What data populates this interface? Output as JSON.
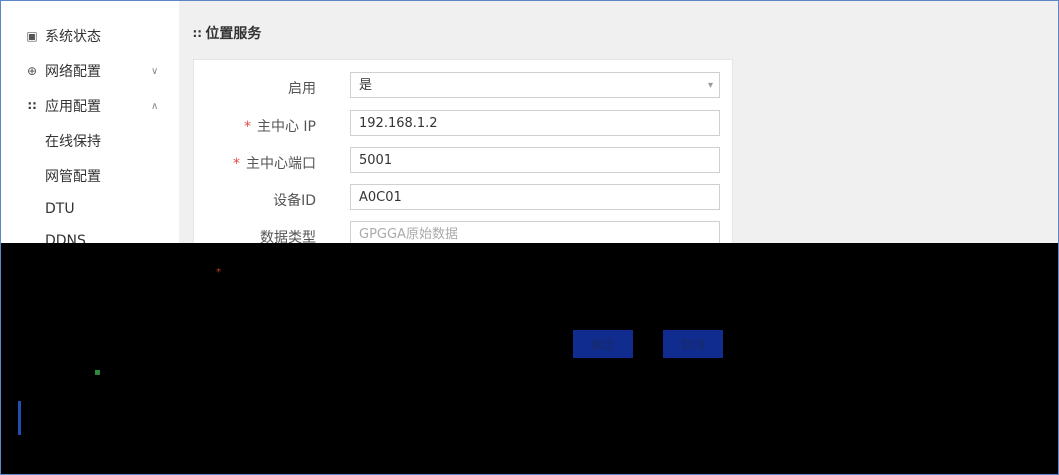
{
  "sidebar": {
    "items": [
      {
        "label": "系统状态",
        "icon": "monitor-icon"
      },
      {
        "label": "网络配置",
        "icon": "globe-icon",
        "caret": "∨"
      },
      {
        "label": "应用配置",
        "icon": "grid-icon",
        "caret": "∧"
      }
    ],
    "subitems": [
      "在线保持",
      "网管配置",
      "DTU",
      "DDNS"
    ]
  },
  "main": {
    "title": "位置服务",
    "form": {
      "enable": {
        "label": "启用",
        "value": "是",
        "options": [
          "是"
        ]
      },
      "center_ip": {
        "label": "主中心 IP",
        "value": "192.168.1.2",
        "required": true
      },
      "center_port": {
        "label": "主中心端口",
        "value": "5001",
        "required": true
      },
      "device_id": {
        "label": "设备ID",
        "value": "A0C01"
      },
      "data_type": {
        "label": "数据类型",
        "placeholder": "GPGGA原始数据"
      }
    },
    "buttons": {
      "confirm": "确定",
      "cancel": "取消"
    }
  },
  "colors": {
    "accent": "#1f4fb0",
    "required": "#e04b4b",
    "button": "#0f2c8e"
  }
}
